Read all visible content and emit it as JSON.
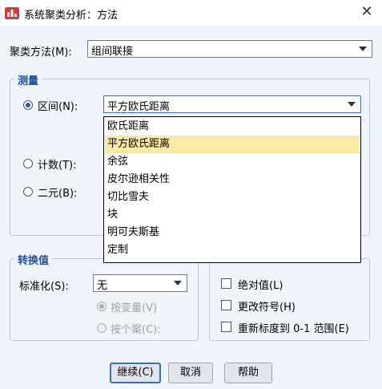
{
  "window": {
    "title": "系统聚类分析：方法",
    "close_glyph": "✕"
  },
  "cluster_method": {
    "label": "聚类方法(M):",
    "value": "组间联接"
  },
  "measure": {
    "group_title": "测量",
    "interval": {
      "label": "区间(N):",
      "selected": true,
      "value": "平方欧氏距离"
    },
    "count": {
      "label": "计数(T):"
    },
    "binary": {
      "label": "二元(B):"
    },
    "dropdown_items": [
      "欧氏距离",
      "平方欧氏距离",
      "余弦",
      "皮尔逊相关性",
      "切比雪夫",
      "块",
      "明可夫斯基",
      "定制"
    ],
    "dropdown_selected": "平方欧氏距离"
  },
  "transform_values": {
    "group_title": "转换值",
    "standardize_label": "标准化(S):",
    "standardize_value": "无",
    "by_variable": "按变量(V)",
    "by_case": "按个案(C):"
  },
  "transform_measures": {
    "absolute": "绝对值(L)",
    "change_sign": "更改符号(H)",
    "rescale": "重新标度到 0-1 范围(E)"
  },
  "buttons": {
    "continue": "继续(C)",
    "cancel": "取消",
    "help": "帮助"
  }
}
